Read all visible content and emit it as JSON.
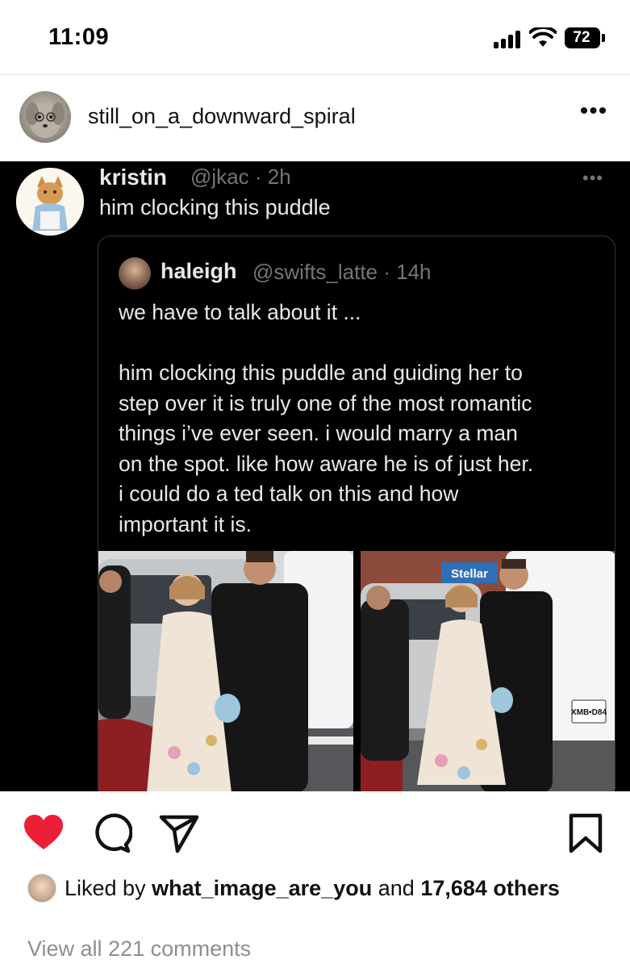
{
  "status_bar": {
    "time": "11:09",
    "battery": "72",
    "icons": [
      "signal-icon",
      "wifi-icon",
      "battery-icon"
    ]
  },
  "post": {
    "username": "still_on_a_downward_spiral",
    "more_icon": "more-horizontal-icon"
  },
  "tweet": {
    "name": "kristin",
    "handle_time": "@jkac · 2h",
    "text": "him clocking this puddle",
    "quote": {
      "name": "haleigh",
      "handle_time": "@swifts_latte · 14h",
      "paragraph1": "we have to talk about it ...",
      "lines": [
        "him clocking this puddle and guiding her to",
        "step over it is truly one of the most romantic",
        "things i’ve ever seen. i would marry a man",
        "on the spot. like how aware he is of just her.",
        "i could do a ted talk on this and how",
        "important it is."
      ],
      "photo_sign_text": "Stellar",
      "photo_plate_text": "XMB•D84"
    }
  },
  "actions": {
    "like_icon": "heart-icon",
    "comment_icon": "comment-icon",
    "share_icon": "send-icon",
    "save_icon": "bookmark-icon",
    "like_color": "#ed1f38"
  },
  "likes": {
    "prefix": "Liked by",
    "user": "what_image_are_you",
    "and": "and",
    "count": "17,684",
    "suffix": "others"
  },
  "comments": {
    "view_all": "View all 221 comments"
  }
}
